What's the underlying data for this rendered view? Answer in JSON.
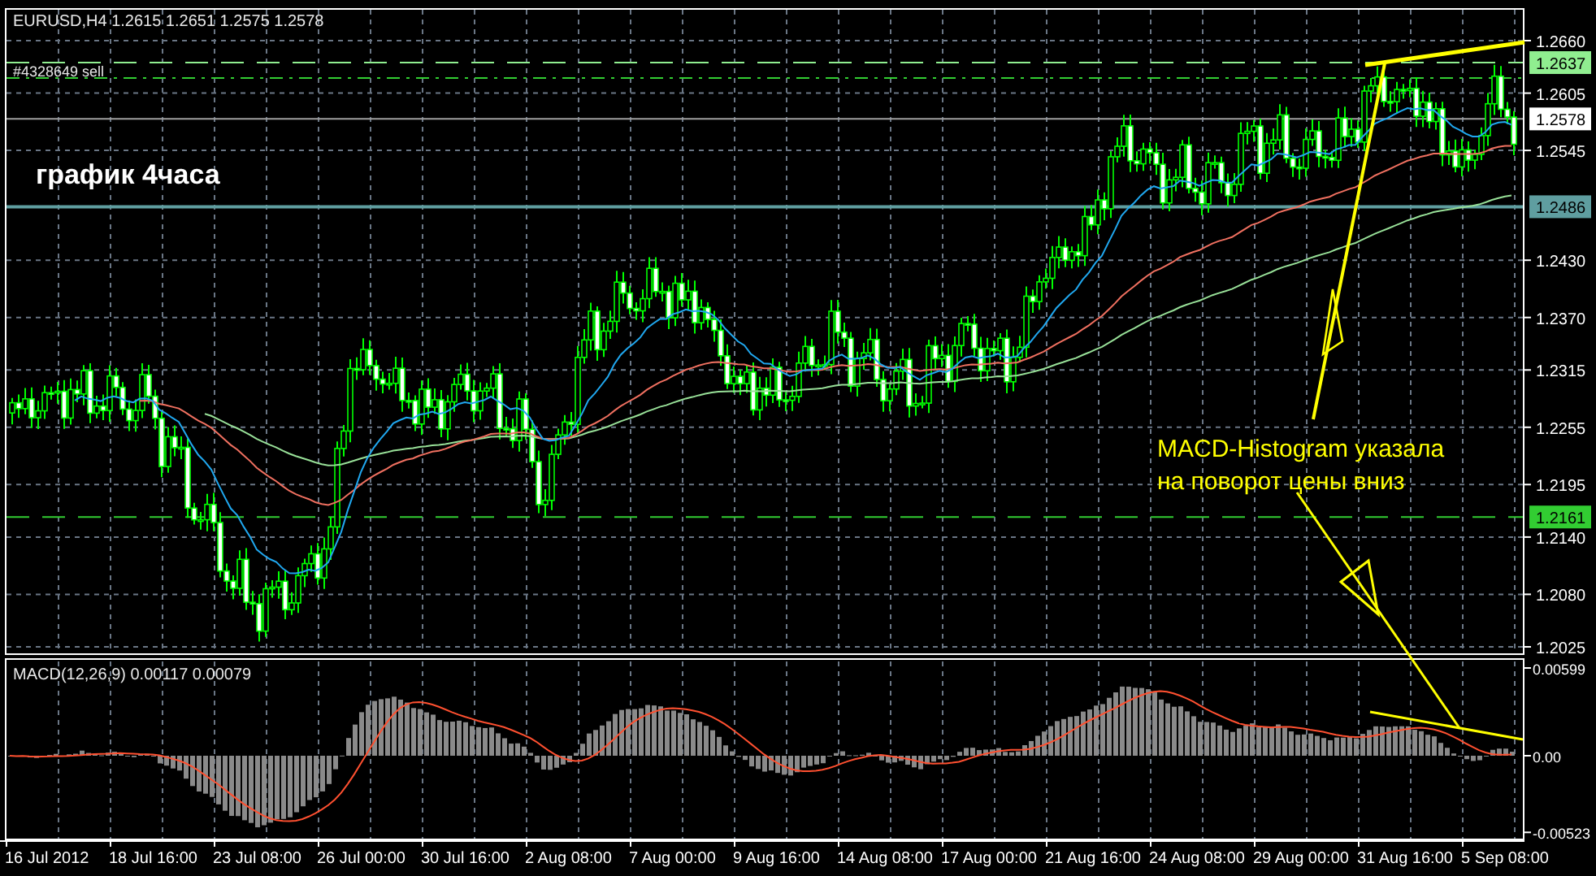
{
  "price_chart": {
    "header": "EURUSD,H4  1.2615 1.2651 1.2575 1.2578",
    "order_label": "#4328649 sell",
    "caption": "график 4часа",
    "annotation": [
      "MACD-Histogram указала",
      "на поворот цены вниз"
    ],
    "price_ticks": [
      "1.2660",
      "1.2605",
      "1.2545",
      "1.2430",
      "1.2370",
      "1.2315",
      "1.2255",
      "1.2195",
      "1.2140",
      "1.2080",
      "1.2025"
    ],
    "price_markers": [
      {
        "label": "1.2637",
        "color": "#90ee90",
        "kind": "order"
      },
      {
        "label": "1.2578",
        "color": "#ffffff",
        "kind": "bid"
      },
      {
        "label": "1.2486",
        "color": "#5f9ea0",
        "kind": "level"
      },
      {
        "label": "1.2161",
        "color": "#32cd32",
        "kind": "order"
      }
    ]
  },
  "macd": {
    "label": "MACD(12,26,9) 0.00117 0.00079",
    "ticks": [
      "0.00599",
      "0.00",
      "-0.00523"
    ]
  },
  "time_axis": {
    "labels": [
      "16 Jul 2012",
      "18 Jul 16:00",
      "23 Jul 08:00",
      "26 Jul 00:00",
      "30 Jul 16:00",
      "2 Aug 08:00",
      "7 Aug 00:00",
      "9 Aug 16:00",
      "14 Aug 08:00",
      "17 Aug 00:00",
      "21 Aug 16:00",
      "24 Aug 08:00",
      "29 Aug 00:00",
      "31 Aug 16:00",
      "5 Sep 08:00"
    ]
  }
}
